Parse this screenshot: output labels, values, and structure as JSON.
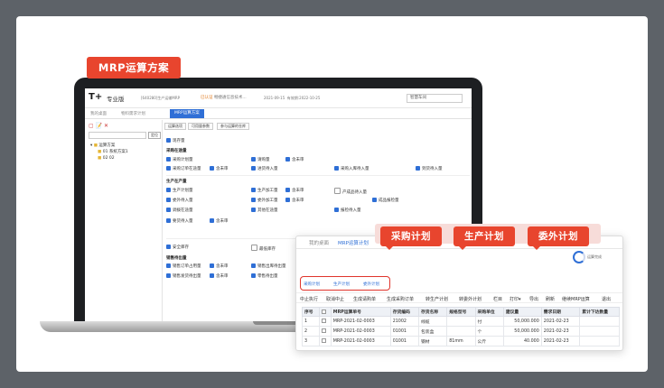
{
  "badge": {
    "label": "MRP运算方案"
  },
  "app": {
    "logo": "T+",
    "logo_text": "专业版",
    "account_info": "[640280]生产运输MRP",
    "cert": "已认证",
    "cert_company": "畅捷通信息技术...",
    "date": "2021-09-15",
    "valid": "有效期:2022-10-25",
    "search_value": "智慧车间"
  },
  "screen_tabs": {
    "home": "我的桌面",
    "other": "物料需求计划",
    "active": "MRP运算方案"
  },
  "left_panel": {
    "tools": "▢ 📝 ✕",
    "search_btn": "定位",
    "tree": [
      "运算方案",
      "01 系统方案1",
      "02 02"
    ]
  },
  "subtabs": [
    "运算选项",
    "可用量参数",
    "参与运算的仓库"
  ],
  "options": {
    "stock": "现存量",
    "purchase_section": "采购在途量",
    "purchase_plan": "采购计划量",
    "request": "请购量",
    "unaudited": "含未审",
    "purchase_order": "采购订单在途量",
    "unaudited2": "含未审",
    "inbound": "进货待入量",
    "purchase_inbound": "采购入库待入量",
    "arrival": "到货待入量",
    "production_section": "生产在产量",
    "production_plan": "生产计划量",
    "production_order": "生产加工量",
    "unaudited3": "含未审",
    "finished": "产成品待入量",
    "outsource": "委外待入量",
    "outsource_order": "委外加工量",
    "unaudited4": "含未审",
    "finished_check": "成品报检量",
    "transfer": "调拨在途量",
    "other_inbound": "其他在途量",
    "arrival_return": "报检待入量",
    "demand": "要货待入量",
    "unaudited5": "含未审",
    "safety": "安全库存",
    "min_stock": "最低库存",
    "sales_section": "销售待出量",
    "sales_order": "销售订单占用量",
    "unaudited6": "含未审",
    "sales_out": "销售出库待出量",
    "sales_ship": "销售发货待出量",
    "unaudited7": "含未审",
    "retail": "零售待出量"
  },
  "popup": {
    "tab_home": "我的桌面",
    "tab_active": "MRP运算计划",
    "tab_close": "×",
    "progress": "运算完成",
    "plan_tabs": [
      "采购计划",
      "生产计划",
      "委外计划"
    ],
    "toolbar": [
      "中止执行",
      "取消中止",
      "生成请购单",
      "生成采购订单",
      "转生产计划",
      "转委外计划",
      "栏目",
      "打印▾",
      "导出",
      "刷新",
      "继续MRP运算",
      "退出"
    ],
    "columns": [
      "序号",
      "",
      "MRP运算单号",
      "存货编码",
      "存货名称",
      "规格型号",
      "采购单位",
      "建议量",
      "需求日期",
      "累计下达数量"
    ],
    "rows": [
      [
        "1",
        "MRP-2021-02-0003",
        "21002",
        "线缆",
        "",
        "付",
        "50,000.000",
        "2021-02-23",
        ""
      ],
      [
        "2",
        "MRP-2021-02-0003",
        "01001",
        "包装盒",
        "",
        "个",
        "50,000.000",
        "2021-02-23",
        ""
      ],
      [
        "3",
        "MRP-2021-02-0003",
        "01001",
        "钢材",
        "81mm",
        "公斤",
        "40.000",
        "2021-02-23",
        ""
      ]
    ]
  },
  "callouts": [
    "采购计划",
    "生产计划",
    "委外计划"
  ],
  "colors": {
    "accent": "#e8452e",
    "blue": "#2f6fd6",
    "frame": "#5d6268"
  }
}
